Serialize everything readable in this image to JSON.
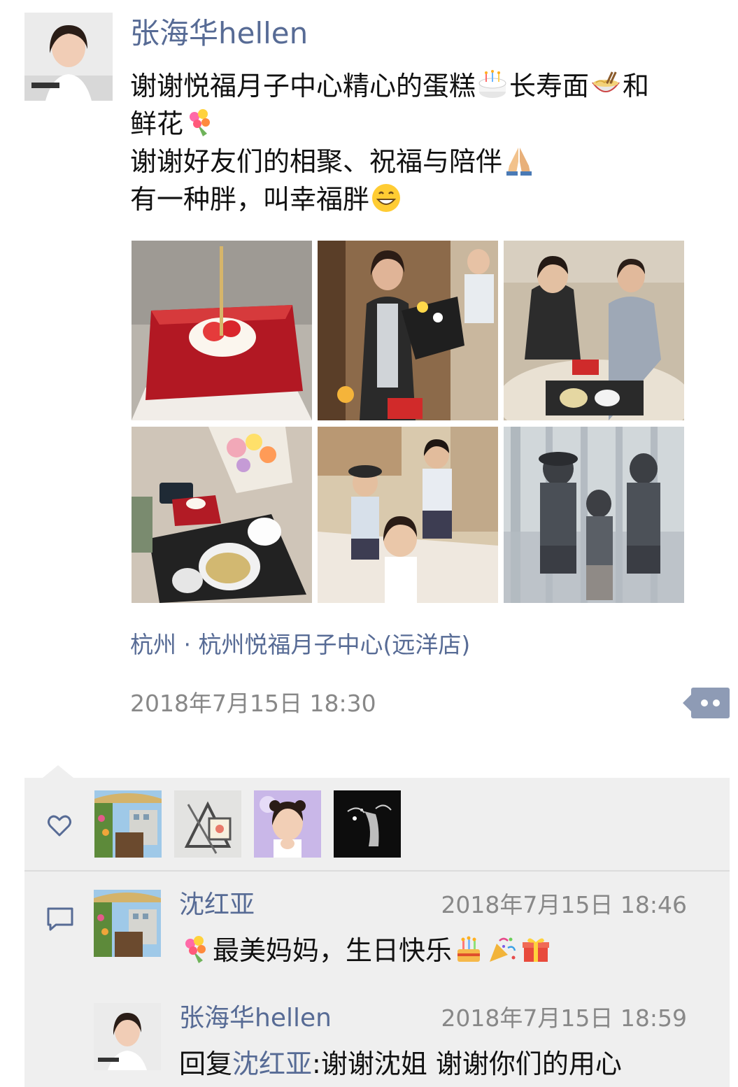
{
  "post": {
    "author": "张海华hellen",
    "text_lines": [
      {
        "a": "谢谢悦福月子中心精心的蛋糕",
        "b": "长寿面",
        "c": "和"
      },
      {
        "a": "鲜花"
      },
      {
        "a": "谢谢好友们的相聚、祝福与陪伴"
      },
      {
        "a": "有一种胖，叫幸福胖"
      }
    ],
    "location": "杭州 · 杭州悦福月子中心(远洋店)",
    "timestamp": "2018年7月15日 18:30",
    "photo_count": 6
  },
  "likes": {
    "count": 4,
    "icon": "heart-outline-icon"
  },
  "comments": [
    {
      "author": "沈红亚",
      "time": "2018年7月15日 18:46",
      "text": "最美妈妈，生日快乐"
    },
    {
      "author": "张海华hellen",
      "time": "2018年7月15日 18:59",
      "reply_prefix": "回复",
      "reply_to": "沈红亚",
      "text": ":谢谢沈姐 谢谢你们的用心"
    }
  ],
  "colors": {
    "link": "#576b95",
    "text": "#111111",
    "muted": "#888888",
    "panel": "#efefef"
  }
}
